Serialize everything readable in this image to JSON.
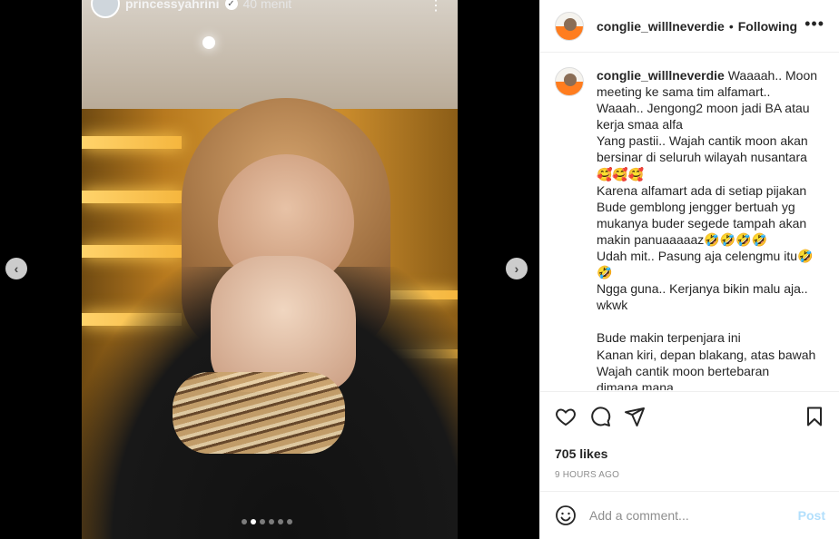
{
  "story": {
    "username": "princessyahrini",
    "verified_icon": "check-icon",
    "time": "40 menit",
    "more_icon": "⋮"
  },
  "carousel": {
    "prev_icon": "‹",
    "next_icon": "›",
    "slide_count": 6,
    "active_index": 1
  },
  "post": {
    "username": "conglie_willlneverdie",
    "separator": "•",
    "follow_status": "Following",
    "more_icon": "•••",
    "caption_lines": [
      "Waaaah.. Moon",
      "meeting ke sama tim alfamart..",
      "Waaah.. Jengong2 moon jadi BA atau",
      "kerja smaa alfa",
      "Yang pastii.. Wajah cantik moon akan",
      "bersinar di seluruh wilayah nusantara",
      "🥰🥰🥰",
      "Karena alfamart ada di setiap pijakan",
      "Bude gemblong jengger bertuah yg",
      "mukanya buder segede tampah akan",
      "makin panuaaaaaz🤣🤣🤣🤣",
      "Udah mit.. Pasung aja celengmu itu🤣",
      "🤣",
      "Ngga guna.. Kerjanya bikin malu aja..",
      "wkwk",
      "",
      "Bude makin terpenjara ini",
      "Kanan kiri, depan blakang, atas bawah",
      "Wajah cantik moon bertebaran",
      "dimana mana"
    ],
    "likes": "705 likes",
    "time_ago": "9 HOURS AGO",
    "comment_placeholder": "Add a comment...",
    "post_label": "Post"
  },
  "colors": {
    "post_disabled": "#b2dffc",
    "text": "#262626",
    "muted": "#8e8e8e"
  }
}
